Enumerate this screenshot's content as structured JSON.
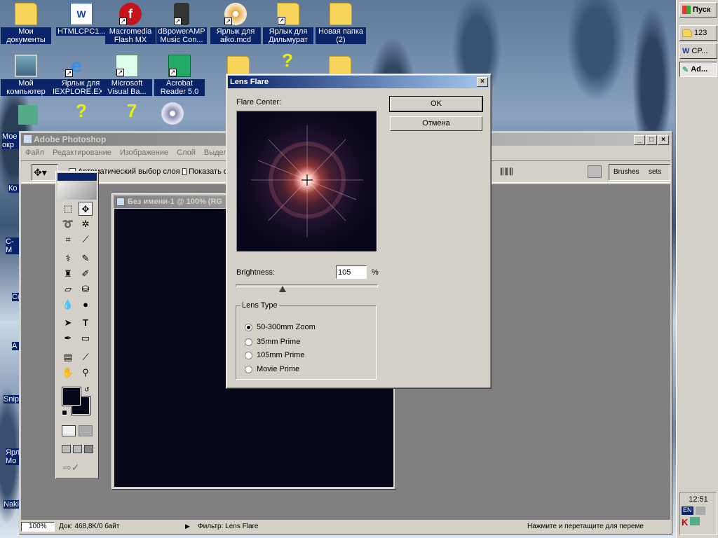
{
  "desktop": {
    "icons": [
      {
        "name": "my-documents",
        "label": "Мои документы"
      },
      {
        "name": "htmlcpc",
        "label": "HTMLCPC1...."
      },
      {
        "name": "flash-mx",
        "label": "Macromedia Flash MX"
      },
      {
        "name": "dbpoweramp",
        "label": "dBpowerAMP Music Con..."
      },
      {
        "name": "aiko",
        "label": "Ярлык для aiko.mcd"
      },
      {
        "name": "dilmurat",
        "label": "Ярлык для Дильмурат"
      },
      {
        "name": "new-folder-2",
        "label": "Новая папка (2)"
      },
      {
        "name": "my-computer",
        "label": "Мой компьютер"
      },
      {
        "name": "iexplore",
        "label": "Ярлык для IEXPLORE.EXE"
      },
      {
        "name": "visual-basic",
        "label": "Microsoft Visual Ba..."
      },
      {
        "name": "acrobat",
        "label": "Acrobat Reader 5.0"
      }
    ],
    "partial_labels": [
      "Мое окр",
      "Ко",
      "C-M",
      "Co",
      "A",
      "Snip",
      "Ярл Мо",
      "Naki"
    ]
  },
  "taskbar": {
    "start_label": "Пуск",
    "items": [
      "123",
      "CP...",
      "Ad..."
    ],
    "clock": "12:51",
    "lang": "EN"
  },
  "photoshop": {
    "title": "Adobe Photoshop",
    "menu": [
      "Файл",
      "Редактирование",
      "Изображение",
      "Слой",
      "Выделе"
    ],
    "options": {
      "auto_select_label": "Автоматический выбор слоя",
      "show_label": "Показать о"
    },
    "palette_tabs": [
      "Brushes",
      "sets"
    ],
    "document_title": "Без имени-1 @ 100% (RG",
    "status": {
      "zoom": "100%",
      "doc_info": "Док: 468,8K/0 байт",
      "filter": "Фильтр: Lens Flare",
      "hint": "Нажмите и перетащите для переме"
    }
  },
  "dialog": {
    "title": "Lens Flare",
    "flare_center_label": "Flare Center:",
    "ok_label": "OK",
    "cancel_label": "Отмена",
    "brightness_label": "Brightness:",
    "brightness_value": "105",
    "brightness_unit": "%",
    "brightness_slider_fraction": 0.33,
    "lens_type_label": "Lens Type",
    "lens_options": [
      "50-300mm Zoom",
      "35mm Prime",
      "105mm Prime",
      "Movie Prime"
    ],
    "selected_lens": "50-300mm Zoom"
  },
  "colors": {
    "title_active": "#0a246a",
    "title_inactive": "#808080",
    "canvas": "#06061a",
    "face": "#d4d0c8"
  }
}
